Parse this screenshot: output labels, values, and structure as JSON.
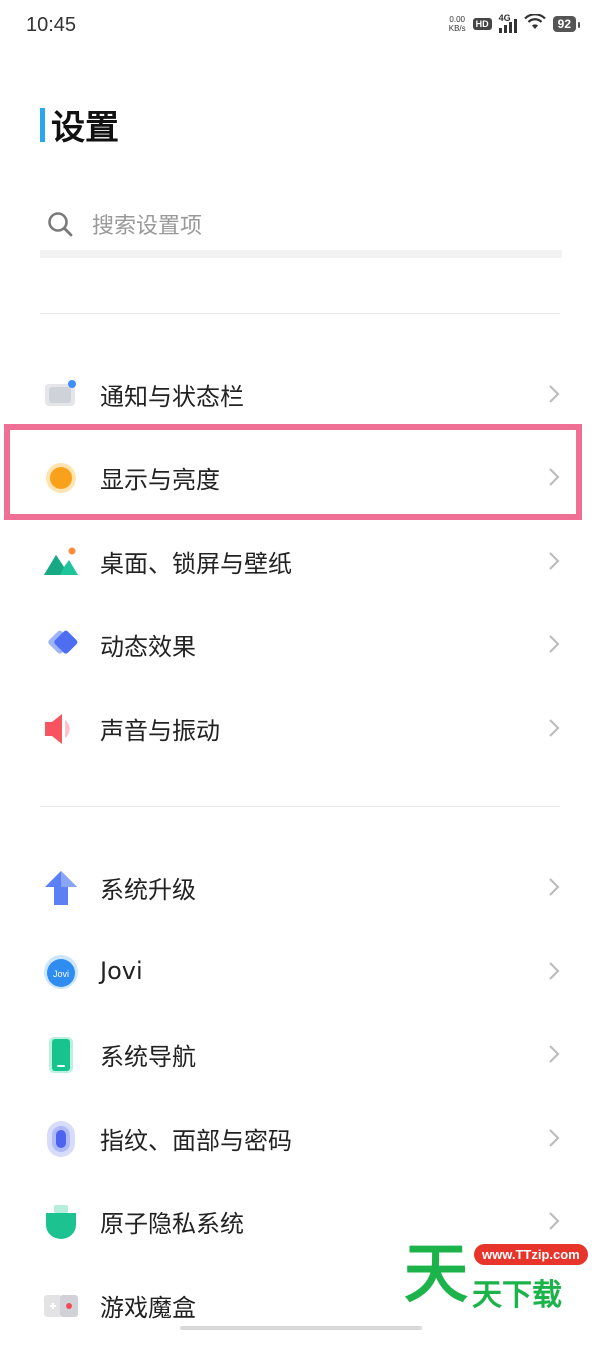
{
  "status": {
    "time": "10:45",
    "net_speed_value": "0.00",
    "net_speed_unit": "KB/s",
    "hd": "HD",
    "network": "4G",
    "battery": "92"
  },
  "title": "设置",
  "search": {
    "placeholder": "搜索设置项"
  },
  "group1": [
    {
      "label": "通知与状态栏",
      "icon": "notification-icon"
    },
    {
      "label": "显示与亮度",
      "icon": "display-brightness-icon",
      "highlighted": true
    },
    {
      "label": "桌面、锁屏与壁纸",
      "icon": "wallpaper-icon"
    },
    {
      "label": "动态效果",
      "icon": "animation-icon"
    },
    {
      "label": "声音与振动",
      "icon": "sound-icon"
    }
  ],
  "group2": [
    {
      "label": "系统升级",
      "icon": "system-update-icon"
    },
    {
      "label": "Jovi",
      "icon": "jovi-icon"
    },
    {
      "label": "系统导航",
      "icon": "navigation-icon"
    },
    {
      "label": "指纹、面部与密码",
      "icon": "fingerprint-icon"
    },
    {
      "label": "原子隐私系统",
      "icon": "privacy-icon"
    },
    {
      "label": "游戏魔盒",
      "icon": "game-box-icon"
    }
  ],
  "watermark": {
    "big": "天",
    "small": "天下载",
    "url": "www.TTzip.com"
  },
  "colors": {
    "highlight": "#f07095",
    "accent": "#2aa7ee"
  }
}
